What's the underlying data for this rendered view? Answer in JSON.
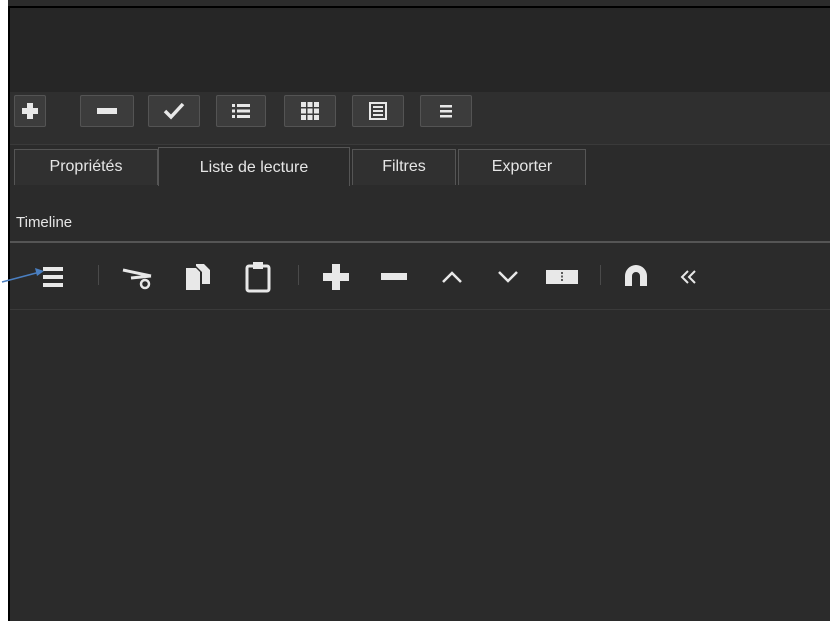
{
  "playlist_toolbar": {
    "buttons": [
      {
        "icon": "plus-icon"
      },
      {
        "icon": "minus-icon"
      },
      {
        "icon": "check-icon"
      },
      {
        "icon": "list-view-icon"
      },
      {
        "icon": "grid-view-icon"
      },
      {
        "icon": "table-view-icon"
      },
      {
        "icon": "menu-icon"
      }
    ]
  },
  "tabs": [
    {
      "label": "Propriétés",
      "active": false
    },
    {
      "label": "Liste de lecture",
      "active": true
    },
    {
      "label": "Filtres",
      "active": false
    },
    {
      "label": "Exporter",
      "active": false
    }
  ],
  "timeline": {
    "label": "Timeline",
    "tools": [
      {
        "icon": "timeline-menu-icon"
      },
      {
        "icon": "cut-icon"
      },
      {
        "icon": "copy-icon"
      },
      {
        "icon": "paste-icon"
      },
      {
        "icon": "append-icon"
      },
      {
        "icon": "remove-icon"
      },
      {
        "icon": "lift-up-icon"
      },
      {
        "icon": "overwrite-down-icon"
      },
      {
        "icon": "split-icon"
      },
      {
        "icon": "snap-magnet-icon"
      },
      {
        "icon": "scrub-back-icon"
      }
    ]
  },
  "colors": {
    "panel": "#2b2b2b",
    "titlebar": "#262626",
    "icon": "#e8e8e8",
    "annotation_arrow": "#4a7fc1"
  }
}
